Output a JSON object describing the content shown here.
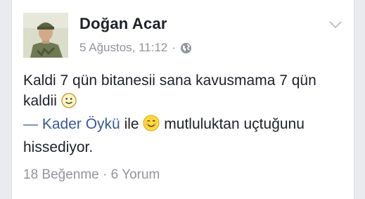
{
  "post": {
    "author": "Doğan Acar",
    "date": "5 Ağustos, 11:12",
    "separator": "·",
    "privacy_icon": "globe-icon",
    "menu_icon": "chevron-down-icon",
    "text_line1": "Kaldi 7 qün bitanesii sana kavusmama 7 qün",
    "text_line2": "kaldii",
    "emoji_1": "smile-emoji",
    "tag_dash": "—",
    "tagged_person": "Kader Öykü",
    "tag_connector": "ile",
    "emoji_2": "blush-emoji",
    "feeling_line1": "mutluluktan uçtuğunu",
    "feeling_line2": "hissediyor."
  },
  "stats": {
    "likes": "18 Beğenme",
    "separator": "·",
    "comments": "6 Yorum"
  },
  "colors": {
    "link": "#365899",
    "muted": "#90949c",
    "text": "#1d2129",
    "background": "#e9ebee"
  }
}
